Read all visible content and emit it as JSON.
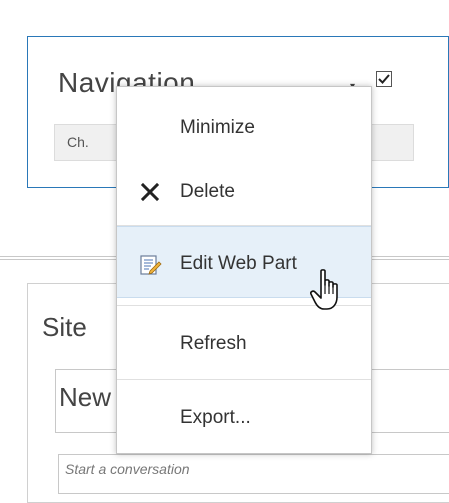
{
  "navigation_part": {
    "title": "Navigation",
    "arrow": "▾",
    "bar_text": "Ch."
  },
  "feed_part": {
    "title": "Site",
    "inner_title": "New",
    "conversation_placeholder": "Start a conversation"
  },
  "context_menu": {
    "items": [
      {
        "label": "Minimize",
        "icon": ""
      },
      {
        "label": "Delete",
        "icon": "x-icon"
      },
      {
        "label": "Edit Web Part",
        "icon": "edit-web-part-icon"
      },
      {
        "label": "Refresh",
        "icon": ""
      },
      {
        "label": "Export...",
        "icon": ""
      }
    ],
    "highlighted_index": 2
  },
  "colors": {
    "accent_border": "#2a78b8",
    "highlight_bg": "#e6f0f9"
  }
}
